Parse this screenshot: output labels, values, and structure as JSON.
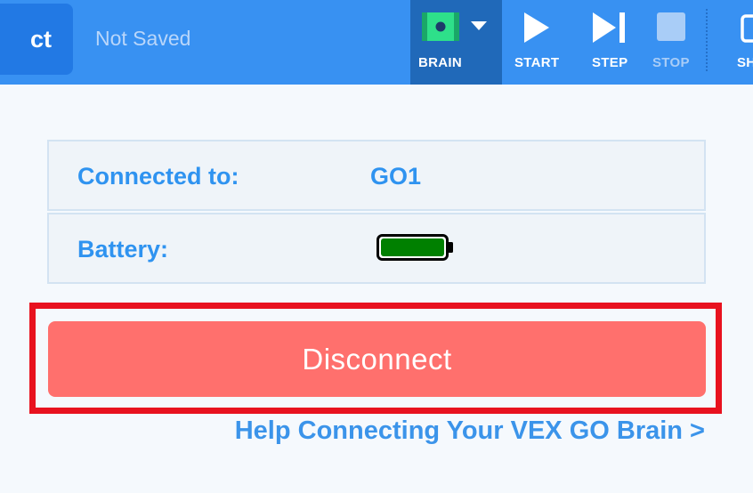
{
  "toolbar": {
    "project_button_label": "ct",
    "save_status": "Not Saved",
    "brain_label": "BRAIN",
    "start_label": "START",
    "step_label": "STEP",
    "stop_label": "STOP",
    "share_label": "SH"
  },
  "connection": {
    "connected_label": "Connected to:",
    "device_name": "GO1",
    "battery_label": "Battery:",
    "battery_level_percent": 100,
    "battery_color": "#008000"
  },
  "actions": {
    "disconnect_label": "Disconnect",
    "help_link": "Help Connecting Your VEX GO Brain >"
  },
  "colors": {
    "toolbar": "#3891f2",
    "accent_text": "#2f93f0",
    "disconnect": "#ff706d",
    "highlight": "#e8121f"
  }
}
